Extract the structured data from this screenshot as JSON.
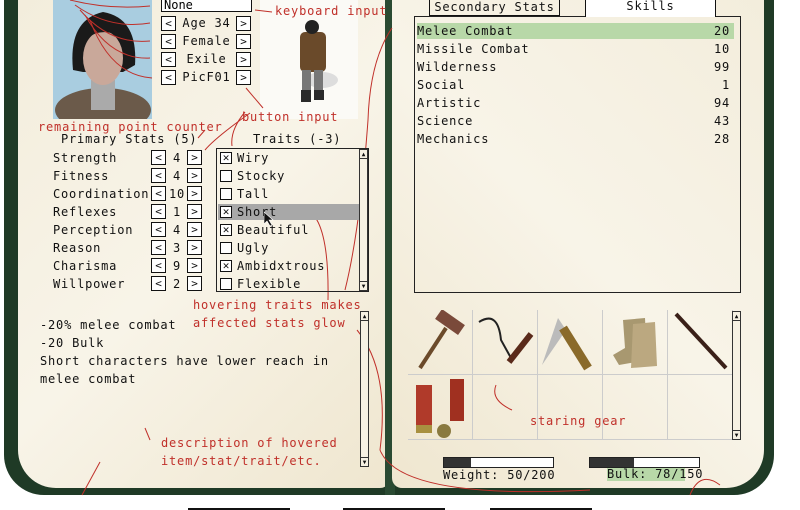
{
  "character": {
    "name_value": "None",
    "age_label": "Age 34",
    "gender_label": "Female",
    "background_label": "Exile",
    "portrait_label": "PicF01"
  },
  "annotations": {
    "keyboard_input": "keyboard input",
    "button_input": "button input",
    "remaining_point_counter": "remaining point counter",
    "hovering_traits_1": "hovering traits makes",
    "hovering_traits_2": "affected stats glow",
    "description_1": "description of hovered",
    "description_2": "item/stat/trait/etc.",
    "starting_gear": "staring gear",
    "color": "#c0302a"
  },
  "primary_stats": {
    "title": "Primary Stats (5)",
    "items": [
      {
        "name": "Strength",
        "value": "4"
      },
      {
        "name": "Fitness",
        "value": "4"
      },
      {
        "name": "Coordination",
        "value": "10"
      },
      {
        "name": "Reflexes",
        "value": "1"
      },
      {
        "name": "Perception",
        "value": "4"
      },
      {
        "name": "Reason",
        "value": "3"
      },
      {
        "name": "Charisma",
        "value": "9"
      },
      {
        "name": "Willpower",
        "value": "2"
      }
    ]
  },
  "traits": {
    "title": "Traits (-3)",
    "items": [
      {
        "name": "Wiry",
        "checked": true
      },
      {
        "name": "Stocky",
        "checked": false
      },
      {
        "name": "Tall",
        "checked": false
      },
      {
        "name": "Short",
        "checked": true,
        "hovered": true
      },
      {
        "name": "Beautiful",
        "checked": true
      },
      {
        "name": "Ugly",
        "checked": false
      },
      {
        "name": "Ambidxtrous",
        "checked": true
      },
      {
        "name": "Flexible",
        "checked": false
      }
    ]
  },
  "description": {
    "lines": [
      "-20% melee combat",
      "-20 Bulk",
      "Short characters have lower reach in",
      "melee combat"
    ]
  },
  "tabs": [
    {
      "label": "Secondary Stats",
      "active": false
    },
    {
      "label": "Skills",
      "active": true
    }
  ],
  "skills": [
    {
      "name": "Melee Combat",
      "value": "20",
      "highlighted": true
    },
    {
      "name": "Missile Combat",
      "value": "10"
    },
    {
      "name": "Wilderness",
      "value": "99"
    },
    {
      "name": "Social",
      "value": "1"
    },
    {
      "name": "Artistic",
      "value": "94"
    },
    {
      "name": "Science",
      "value": "43"
    },
    {
      "name": "Mechanics",
      "value": "28"
    }
  ],
  "gear": [
    "hammer-icon",
    "hook-icon",
    "knife-icon",
    "boots-icon",
    "baton-icon",
    "shotgun-shells-icon"
  ],
  "weight": {
    "label": "Weight: 50/200",
    "fraction": 0.25
  },
  "bulk": {
    "label": "Bulk: 78/150",
    "fraction": 0.4,
    "highlight": "#b8d8a8"
  },
  "colors": {
    "highlight_green": "#b8d8a8",
    "hover_gray": "#a8a8a8",
    "book_green": "#1f3a26"
  }
}
